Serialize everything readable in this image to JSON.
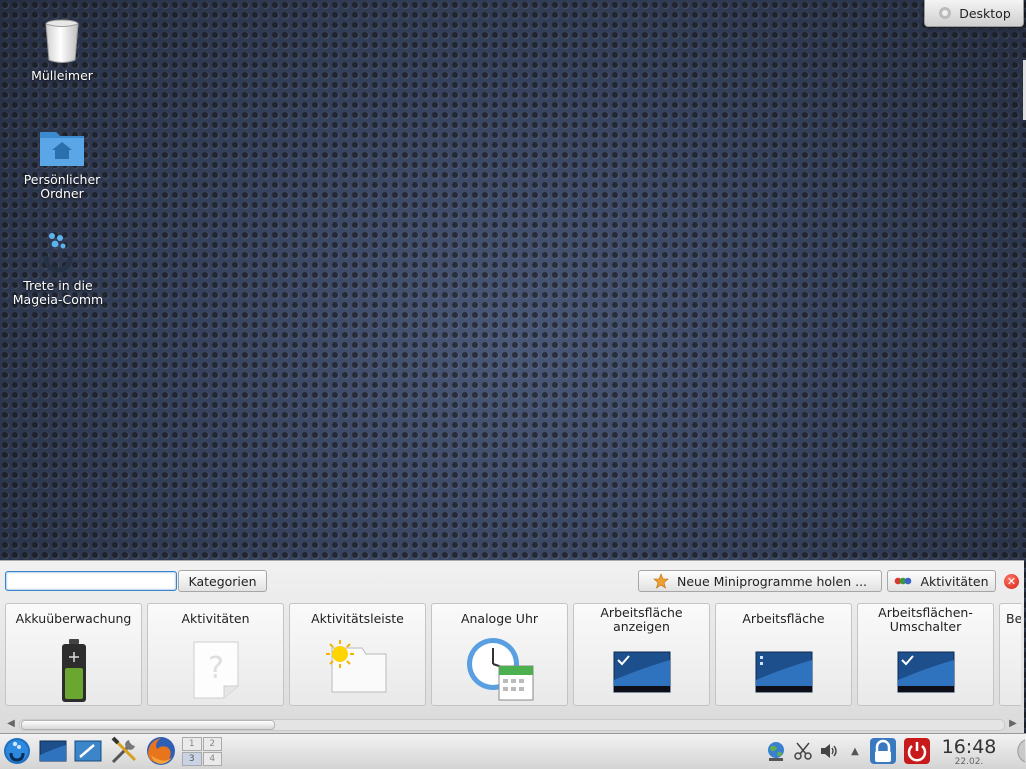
{
  "desktop": {
    "icons": [
      {
        "label": "Mülleimer"
      },
      {
        "label_line1": "Persönlicher",
        "label_line2": "Ordner"
      },
      {
        "label_line1": "Trete in die",
        "label_line2": "Mageia-Comm"
      }
    ],
    "toolbox_label": "Desktop"
  },
  "explorer": {
    "search_value": "",
    "categories_label": "Kategorien",
    "new_widgets_label": "Neue Miniprogramme holen ...",
    "activities_label": "Aktivitäten",
    "widgets": [
      {
        "name": "Akkuüberwachung"
      },
      {
        "name": "Aktivitäten"
      },
      {
        "name": "Aktivitätsleiste"
      },
      {
        "name": "Analoge Uhr"
      },
      {
        "line1": "Arbeitsfläche",
        "line2": "anzeigen"
      },
      {
        "name": "Arbeitsfläche"
      },
      {
        "line1": "Arbeitsflächen-",
        "line2": "Umschalter"
      },
      {
        "name": "Be"
      }
    ]
  },
  "taskbar": {
    "pager": [
      "1",
      "2",
      "3",
      "4"
    ],
    "clock_time": "16:48",
    "clock_date": "22.02."
  },
  "colors": {
    "accent_blue": "#3a83c9",
    "close_red": "#d11e10",
    "logout_red": "#c81a1a"
  }
}
